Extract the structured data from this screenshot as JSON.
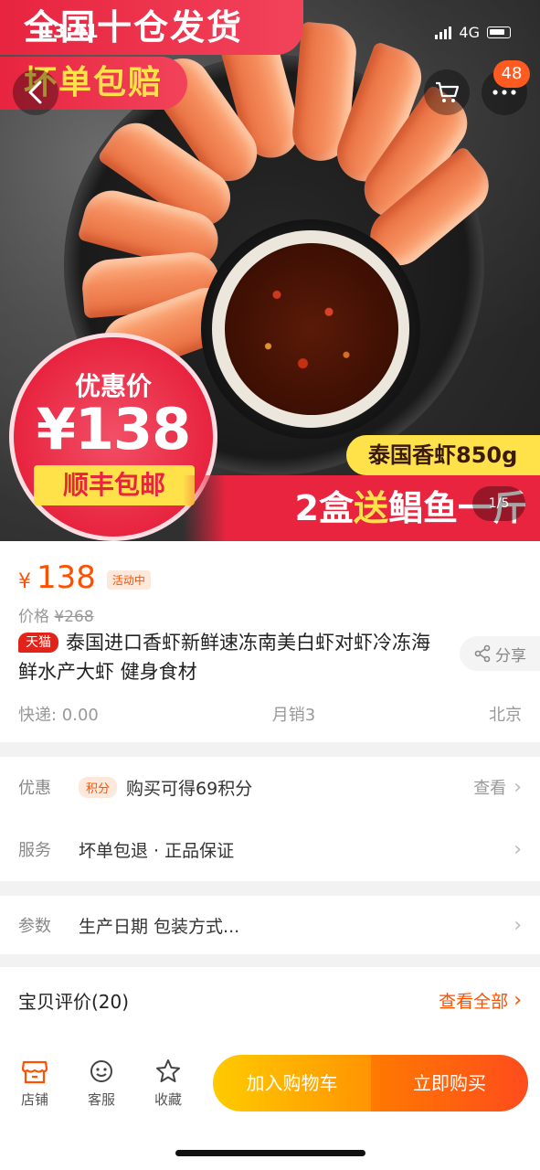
{
  "status": {
    "time": "13:41",
    "network": "4G"
  },
  "nav": {
    "cart_badge": "48"
  },
  "hero": {
    "banner_top": "全国十仓发货",
    "banner_sub": "坏单包赔",
    "badge_label": "优惠价",
    "badge_price": "¥138",
    "badge_ship": "顺丰包邮",
    "weight_tag": "泰国香虾850g",
    "strip_pre": "2盒",
    "strip_hl": "送",
    "strip_post": "鲳鱼一斤",
    "pager": "1/5"
  },
  "product": {
    "currency": "¥",
    "price": "138",
    "activity_tag": "活动中",
    "orig_label": "价格",
    "orig_price": "¥268",
    "store_tag": "天猫",
    "title": "泰国进口香虾新鲜速冻南美白虾对虾冷冻海鲜水产大虾 健身食材",
    "share": "分享",
    "shipping": "快递: 0.00",
    "monthly_sales": "月销3",
    "location": "北京"
  },
  "rows": {
    "promo_label": "优惠",
    "promo_tag": "积分",
    "promo_text": "购买可得69积分",
    "promo_right": "查看",
    "service_label": "服务",
    "service_text": "坏单包退 · 正品保证",
    "params_label": "参数",
    "params_text": "生产日期 包装方式..."
  },
  "review": {
    "title": "宝贝评价(20)",
    "view_all": "查看全部"
  },
  "bottom": {
    "store": "店铺",
    "service": "客服",
    "favorite": "收藏",
    "add_cart": "加入购物车",
    "buy_now": "立即购买"
  },
  "colors": {
    "accent": "#ff5000",
    "tmall_red": "#e2231a",
    "banner_red": "#e8243f",
    "banner_yellow": "#ffe14a"
  }
}
